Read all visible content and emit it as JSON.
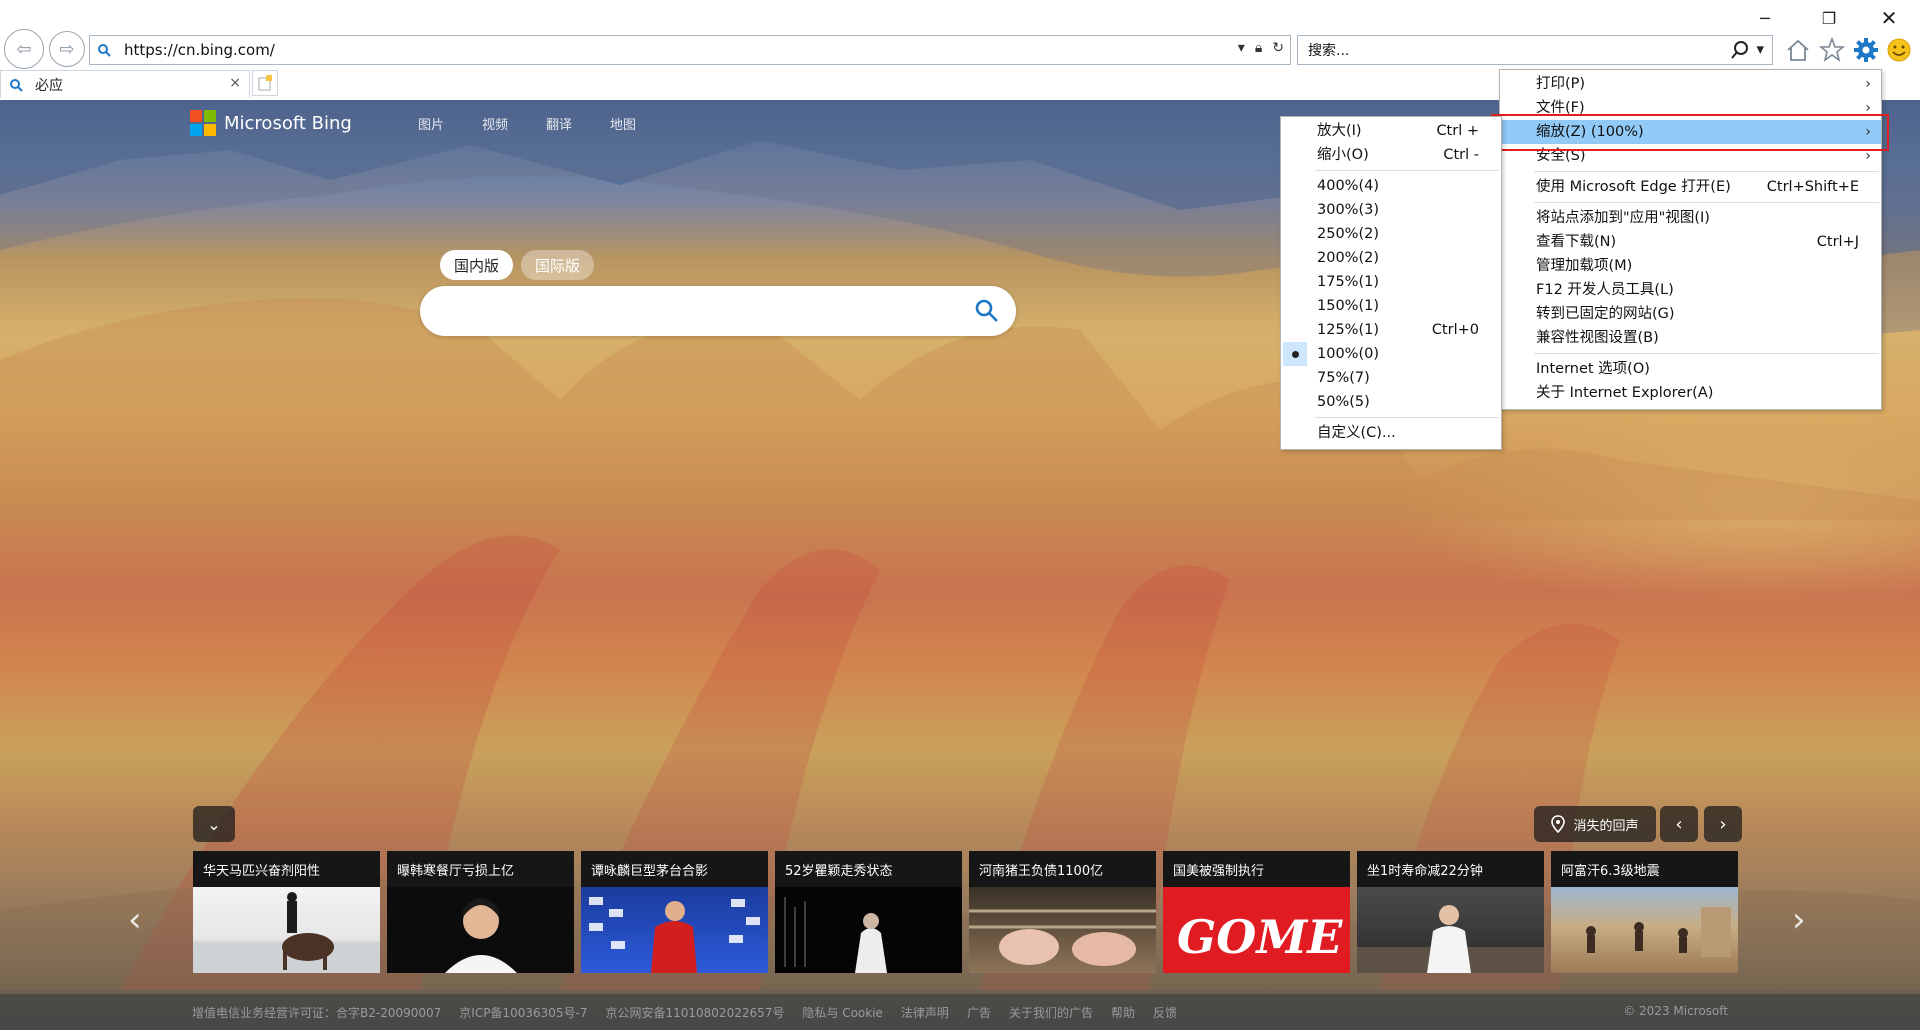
{
  "browser": {
    "url": "https://cn.bing.com/",
    "search_placeholder": "搜索...",
    "tab_title": "必应",
    "tab_close": "×"
  },
  "bing": {
    "logo_text": "Microsoft Bing",
    "nav": [
      "图片",
      "视频",
      "翻译",
      "地图"
    ],
    "modes": [
      "国内版",
      "国际版"
    ],
    "location_label": "消失的回声"
  },
  "news": [
    {
      "title": "华天马匹兴奋剂阳性"
    },
    {
      "title": "曝韩寒餐厅亏损上亿"
    },
    {
      "title": "谭咏麟巨型茅台合影"
    },
    {
      "title": "52岁瞿颖走秀状态"
    },
    {
      "title": "河南猪王负债1100亿"
    },
    {
      "title": "国美被强制执行"
    },
    {
      "title": "坐1时寿命减22分钟"
    },
    {
      "title": "阿富汗6.3级地震"
    }
  ],
  "footer": {
    "links": [
      "增值电信业务经营许可证：合字B2-20090007",
      "京ICP备10036305号-7",
      "京公网安备11010802022657号",
      "隐私与 Cookie",
      "法律声明",
      "广告",
      "关于我们的广告",
      "帮助",
      "反馈"
    ],
    "copyright": "© 2023 Microsoft"
  },
  "tools_menu": {
    "items": [
      {
        "label": "打印(P)",
        "shortcut": "",
        "sub": true
      },
      {
        "label": "文件(F)",
        "shortcut": "",
        "sub": true
      },
      {
        "label": "缩放(Z) (100%)",
        "shortcut": "",
        "sub": true,
        "highlighted": true
      },
      {
        "label": "安全(S)",
        "shortcut": "",
        "sub": true
      },
      {
        "label": "使用 Microsoft Edge 打开(E)",
        "shortcut": "Ctrl+Shift+E",
        "sub": false
      },
      {
        "label": "将站点添加到\"应用\"视图(I)",
        "shortcut": "",
        "sub": false
      },
      {
        "label": "查看下载(N)",
        "shortcut": "Ctrl+J",
        "sub": false
      },
      {
        "label": "管理加载项(M)",
        "shortcut": "",
        "sub": false
      },
      {
        "label": "F12 开发人员工具(L)",
        "shortcut": "",
        "sub": false
      },
      {
        "label": "转到已固定的网站(G)",
        "shortcut": "",
        "sub": false
      },
      {
        "label": "兼容性视图设置(B)",
        "shortcut": "",
        "sub": false
      },
      {
        "label": "Internet 选项(O)",
        "shortcut": "",
        "sub": false
      },
      {
        "label": "关于 Internet Explorer(A)",
        "shortcut": "",
        "sub": false
      }
    ]
  },
  "zoom_menu": {
    "items": [
      {
        "label": "放大(I)",
        "shortcut": "Ctrl +"
      },
      {
        "label": "缩小(O)",
        "shortcut": "Ctrl -"
      },
      {
        "label": "400%(4)",
        "shortcut": ""
      },
      {
        "label": "300%(3)",
        "shortcut": ""
      },
      {
        "label": "250%(2)",
        "shortcut": ""
      },
      {
        "label": "200%(2)",
        "shortcut": ""
      },
      {
        "label": "175%(1)",
        "shortcut": ""
      },
      {
        "label": "150%(1)",
        "shortcut": ""
      },
      {
        "label": "125%(1)",
        "shortcut": "Ctrl+0"
      },
      {
        "label": "100%(0)",
        "shortcut": "",
        "selected": true
      },
      {
        "label": "75%(7)",
        "shortcut": ""
      },
      {
        "label": "50%(5)",
        "shortcut": ""
      },
      {
        "label": "自定义(C)...",
        "shortcut": ""
      }
    ]
  },
  "colors": {
    "menu_highlight": "#91c9f7",
    "red_frame": "#e02020",
    "ie_gear": "#1e78c8"
  }
}
